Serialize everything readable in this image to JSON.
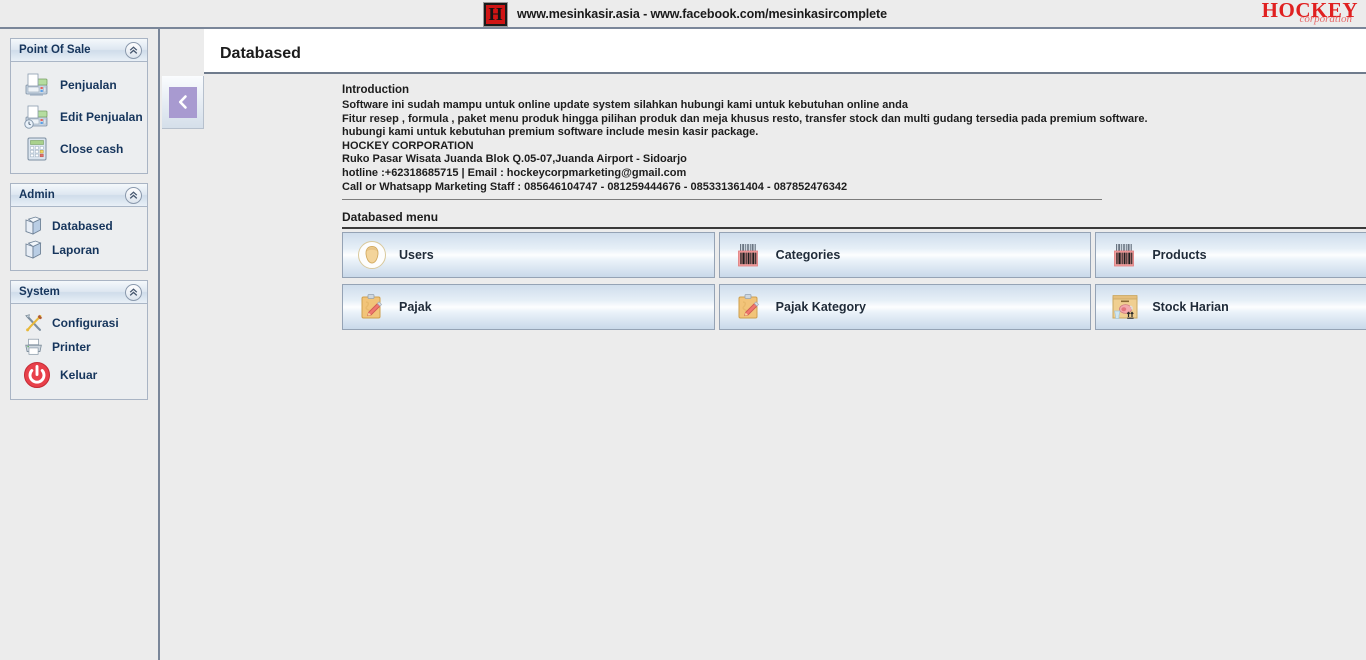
{
  "banner": {
    "logo_mark": "h-monogram-icon",
    "text": "www.mesinkasir.asia - www.facebook.com/mesinkasircomplete",
    "brand_word": "HOCKEY",
    "brand_script": "corporation",
    "brand_color": "#e02020"
  },
  "sidebar": {
    "panels": [
      {
        "title": "Point Of Sale",
        "collapse_icon": "double-chevron-up-icon",
        "items": [
          {
            "label": "Penjualan",
            "icon": "cash-register-icon"
          },
          {
            "label": "Edit Penjualan",
            "icon": "cash-register-edit-icon"
          },
          {
            "label": "Close cash",
            "icon": "calculator-icon"
          }
        ]
      },
      {
        "title": "Admin",
        "collapse_icon": "double-chevron-up-icon",
        "items": [
          {
            "label": "Databased",
            "icon": "book-icon"
          },
          {
            "label": "Laporan",
            "icon": "book-icon"
          }
        ]
      },
      {
        "title": "System",
        "collapse_icon": "double-chevron-up-icon",
        "items": [
          {
            "label": "Configurasi",
            "icon": "wrench-screwdriver-icon"
          },
          {
            "label": "Printer",
            "icon": "printer-icon"
          },
          {
            "label": "Keluar",
            "icon": "power-off-icon"
          }
        ]
      }
    ]
  },
  "main": {
    "page_title": "Databased",
    "collapse_sidebar_icon": "chevron-left-icon",
    "collapse_sidebar_color": "#a89ad0",
    "intro": {
      "heading": "Introduction",
      "lines": [
        "Software ini sudah mampu untuk online update system silahkan hubungi kami untuk kebutuhan online anda",
        "Fitur resep , formula , paket menu produk hingga pilihan produk dan meja khusus resto, transfer stock dan multi gudang tersedia pada premium software.",
        "hubungi kami untuk kebutuhan premium software include mesin kasir package.",
        "HOCKEY CORPORATION",
        "Ruko Pasar Wisata Juanda Blok Q.05-07,Juanda Airport - Sidoarjo",
        "hotline :+62318685715 | Email : hockeycorpmarketing@gmail.com",
        "Call or Whatsapp Marketing Staff : 085646104747 - 081259444676 - 085331361404 - 087852476342"
      ]
    },
    "section_label": "Databased menu",
    "menu_rows": [
      [
        {
          "label": "Users",
          "icon": "user-avatar-icon"
        },
        {
          "label": "Categories",
          "icon": "barcode-icon"
        },
        {
          "label": "Products",
          "icon": "barcode-icon"
        }
      ],
      [
        {
          "label": "Pajak",
          "icon": "clipboard-pencil-icon"
        },
        {
          "label": "Pajak Kategory",
          "icon": "clipboard-pencil-icon"
        },
        {
          "label": "Stock Harian",
          "icon": "stock-box-icon"
        }
      ]
    ]
  }
}
